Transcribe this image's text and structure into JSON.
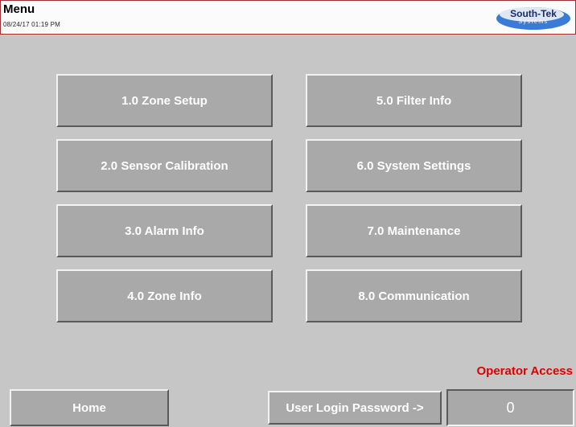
{
  "header": {
    "title": "Menu",
    "datetime": "08/24/17   01:19 PM",
    "logo": {
      "text": "South-Tek",
      "subtext": "Systems"
    }
  },
  "menu": {
    "zone_setup": "1.0 Zone Setup",
    "sensor_calibration": "2.0 Sensor Calibration",
    "alarm_info": "3.0 Alarm Info",
    "zone_info": "4.0 Zone Info",
    "filter_info": "5.0 Filter Info",
    "system_settings": "6.0 System Settings",
    "maintenance": "7.0 Maintenance",
    "communication": "8.0 Communication"
  },
  "footer": {
    "access_level": "Operator Access",
    "home_label": "Home",
    "login_label": "User Login Password ->",
    "password_value": "0"
  },
  "colors": {
    "background": "#c6c6c6",
    "button": "#a9a9a9",
    "access_text": "#e00000",
    "header_border": "#a03030"
  }
}
